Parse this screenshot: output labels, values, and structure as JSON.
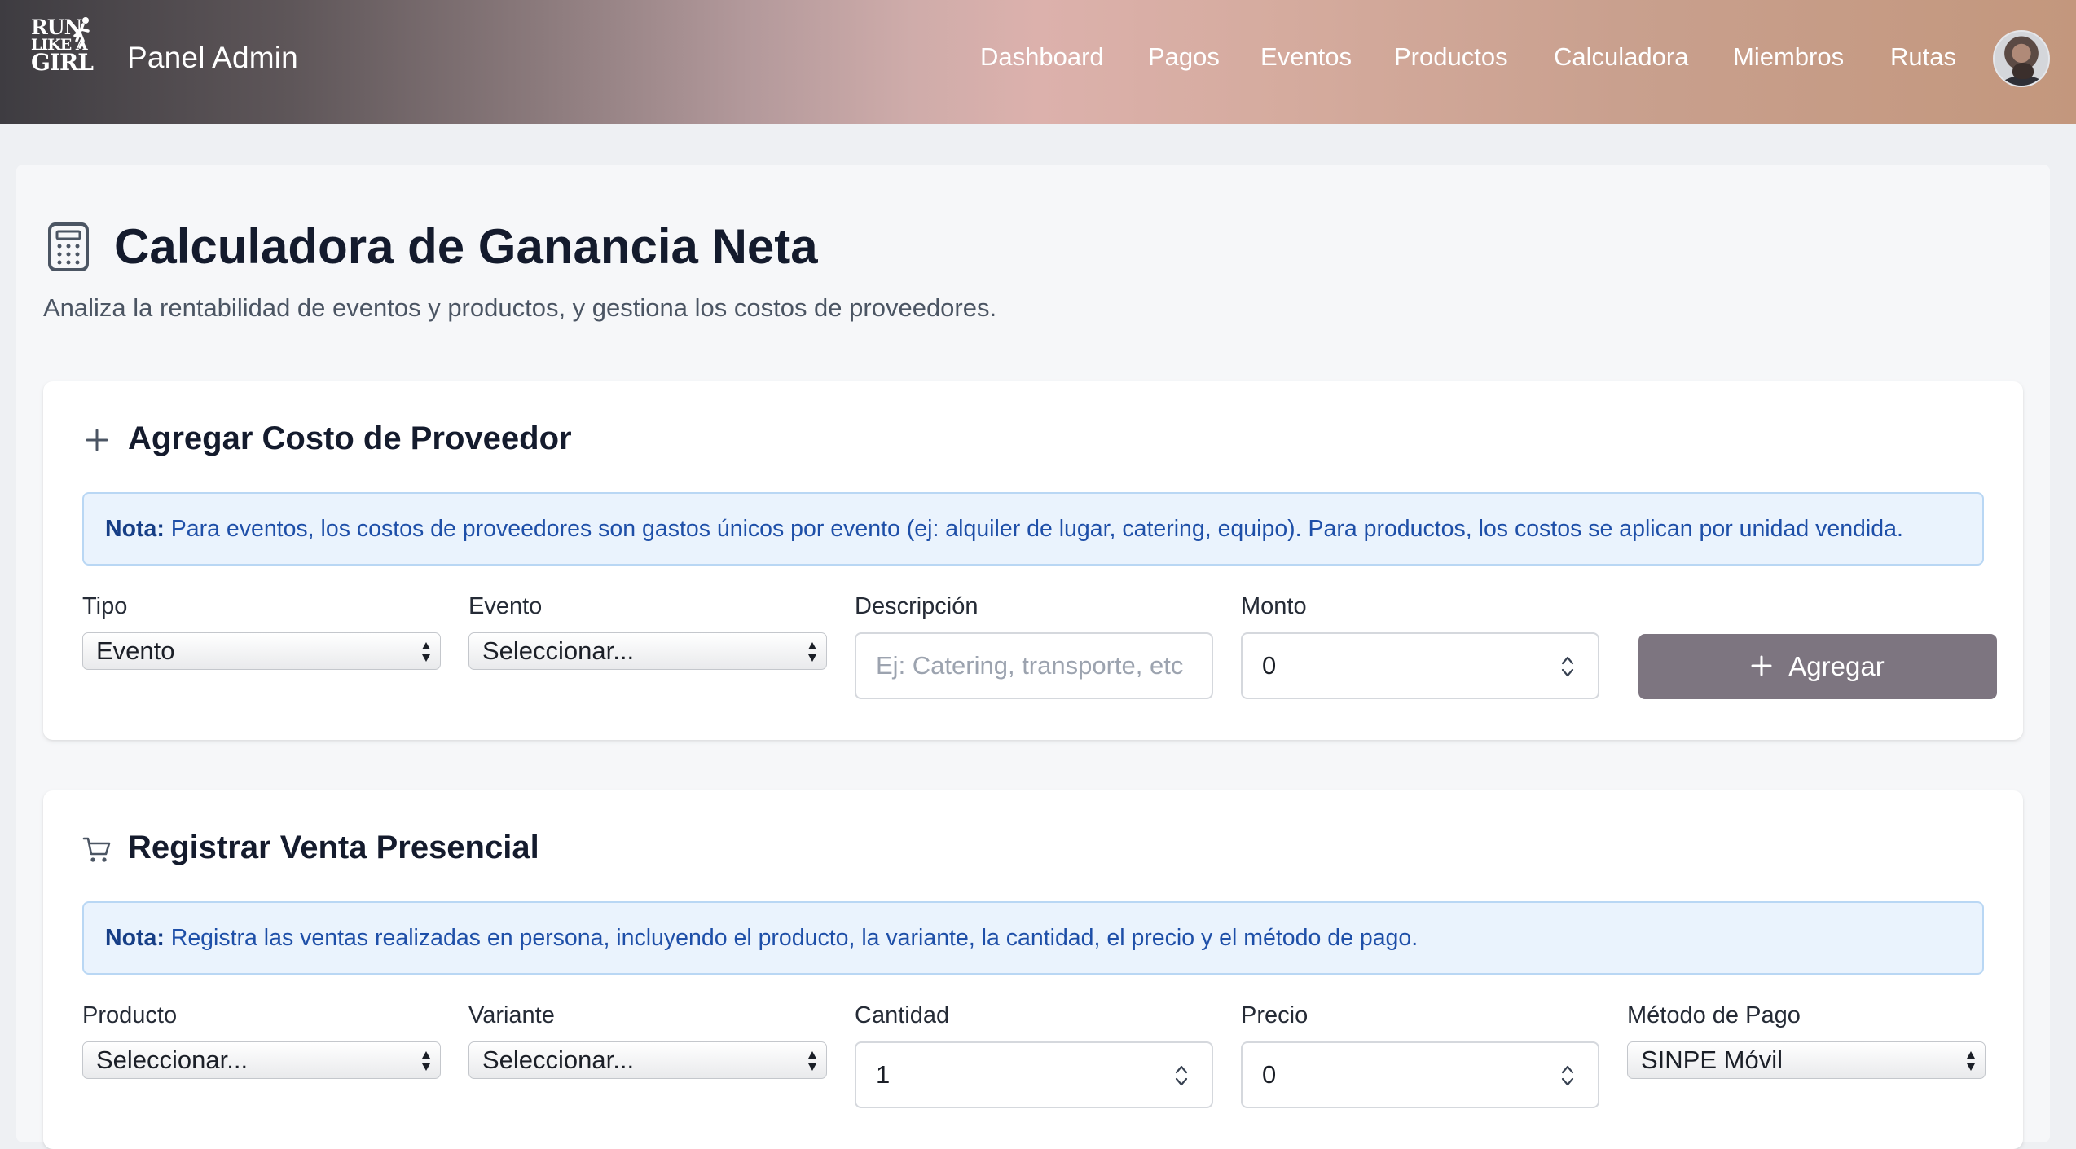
{
  "header": {
    "logo": {
      "line1": "RUN",
      "line2": "LIKE A",
      "line3": "GIRL",
      "icon": "runner-logo-icon"
    },
    "brand": "Panel Admin",
    "nav": [
      {
        "label": "Dashboard"
      },
      {
        "label": "Pagos"
      },
      {
        "label": "Eventos"
      },
      {
        "label": "Productos"
      },
      {
        "label": "Calculadora"
      },
      {
        "label": "Miembros"
      },
      {
        "label": "Rutas"
      }
    ],
    "avatar_icon": "user-avatar"
  },
  "page": {
    "icon": "calculator-icon",
    "title": "Calculadora de Ganancia Neta",
    "subtitle": "Analiza la rentabilidad de eventos y productos, y gestiona los costos de proveedores."
  },
  "supplier_cost": {
    "icon": "plus-icon",
    "title": "Agregar Costo de Proveedor",
    "note_label": "Nota:",
    "note_text": " Para eventos, los costos de proveedores son gastos únicos por evento (ej: alquiler de lugar, catering, equipo). Para productos, los costos se aplican por unidad vendida.",
    "fields": {
      "tipo": {
        "label": "Tipo",
        "value": "Evento"
      },
      "evento": {
        "label": "Evento",
        "value": "Seleccionar..."
      },
      "descripcion": {
        "label": "Descripción",
        "placeholder": "Ej: Catering, transporte, etc"
      },
      "monto": {
        "label": "Monto",
        "value": "0"
      }
    },
    "add_button": "Agregar"
  },
  "in_person_sale": {
    "icon": "cart-icon",
    "title": "Registrar Venta Presencial",
    "note_label": "Nota:",
    "note_text": " Registra las ventas realizadas en persona, incluyendo el producto, la variante, la cantidad, el precio y el método de pago.",
    "fields": {
      "producto": {
        "label": "Producto",
        "value": "Seleccionar..."
      },
      "variante": {
        "label": "Variante",
        "value": "Seleccionar..."
      },
      "cantidad": {
        "label": "Cantidad",
        "value": "1"
      },
      "precio": {
        "label": "Precio",
        "value": "0"
      },
      "metodo_pago": {
        "label": "Método de Pago",
        "value": "SINPE Móvil"
      }
    }
  },
  "colors": {
    "add_button": "#7d7580",
    "note_background": "#eaf3fd",
    "note_text": "#1e4fa8"
  }
}
